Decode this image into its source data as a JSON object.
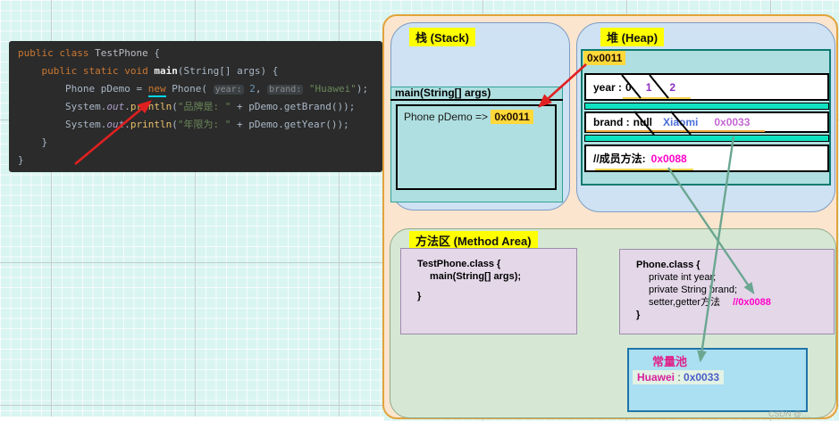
{
  "colors": {
    "panel_bg": "#FBE5CE",
    "panel_border": "#E2A33B",
    "region_blue": "#CFE2F3",
    "region_green": "#D6E8D4",
    "teal_box": "#AFDFE0",
    "separator_teal": "#0FE2C1",
    "highlight_yellow": "#FFD83A",
    "label_yellow": "#FFFF00",
    "magenta_value": "#FF00C8",
    "violet_value": "#C468D2",
    "blue_value": "#4A6FD8",
    "purple_value": "#8E2FBF",
    "red_arrow": "#E02020",
    "green_arrow": "#6BA690",
    "code_bg": "#2B2B2B"
  },
  "code": {
    "lines": [
      [
        [
          "kw",
          "public class "
        ],
        [
          "cls",
          "TestPhone"
        ],
        [
          "pl",
          " {"
        ]
      ],
      [
        [
          "pl",
          "    "
        ],
        [
          "kw",
          "public static void "
        ],
        [
          "fn",
          "main"
        ],
        [
          "pl",
          "(String[] args) {"
        ]
      ],
      [
        [
          "pl",
          "        Phone pDemo = "
        ],
        [
          "new",
          "new"
        ],
        [
          "pl",
          " Phone( "
        ],
        [
          "hint",
          "year:"
        ],
        [
          "num",
          " 2"
        ],
        [
          "pl",
          ", "
        ],
        [
          "hint",
          "brand:"
        ],
        [
          "str",
          " \"Huawei\""
        ],
        [
          "pl",
          ");"
        ]
      ],
      [
        [
          "pl",
          "        System."
        ],
        [
          "fld",
          "out"
        ],
        [
          "pl",
          "."
        ],
        [
          "call",
          "println"
        ],
        [
          "pl",
          "("
        ],
        [
          "str",
          "\"品牌是: \""
        ],
        [
          "pl",
          " + pDemo.getBrand());"
        ]
      ],
      [
        [
          "pl",
          "        System."
        ],
        [
          "fld",
          "out"
        ],
        [
          "pl",
          "."
        ],
        [
          "call",
          "println"
        ],
        [
          "pl",
          "("
        ],
        [
          "str",
          "\"年限为: \""
        ],
        [
          "pl",
          " + pDemo.getYear());"
        ]
      ],
      [
        [
          "pl",
          "    }"
        ]
      ],
      [
        [
          "pl",
          "}"
        ]
      ]
    ]
  },
  "diagram": {
    "stack": {
      "title": "栈 (Stack)",
      "frame_title": "main(String[] args)",
      "var_label": "Phone pDemo => ",
      "var_value": "0x0011"
    },
    "heap": {
      "title": "堆 (Heap)",
      "address": "0x0011",
      "year": {
        "label": "year :",
        "v0": "0",
        "v1": "1",
        "v2": "2"
      },
      "brand": {
        "label": "brand :",
        "v0": "null",
        "v1": "Xiaomi",
        "v2": "0x0033"
      },
      "methods": {
        "label": "//成员方法:",
        "value": "0x0088"
      }
    },
    "method_area": {
      "title": "方法区 (Method Area)",
      "testphone": {
        "l1": "TestPhone.class {",
        "l2": "main(String[] args);",
        "l3": "}"
      },
      "phone": {
        "l1": "Phone.class {",
        "l2": "private int year;",
        "l3": "private String brand;",
        "l4": "setter,getter方法",
        "l4_addr": "//0x0088",
        "l5": "}"
      },
      "pool": {
        "title": "常量池",
        "name": "Huawei",
        "sep": " : ",
        "value": "0x0033"
      }
    },
    "watermark": "CSDN @…"
  }
}
